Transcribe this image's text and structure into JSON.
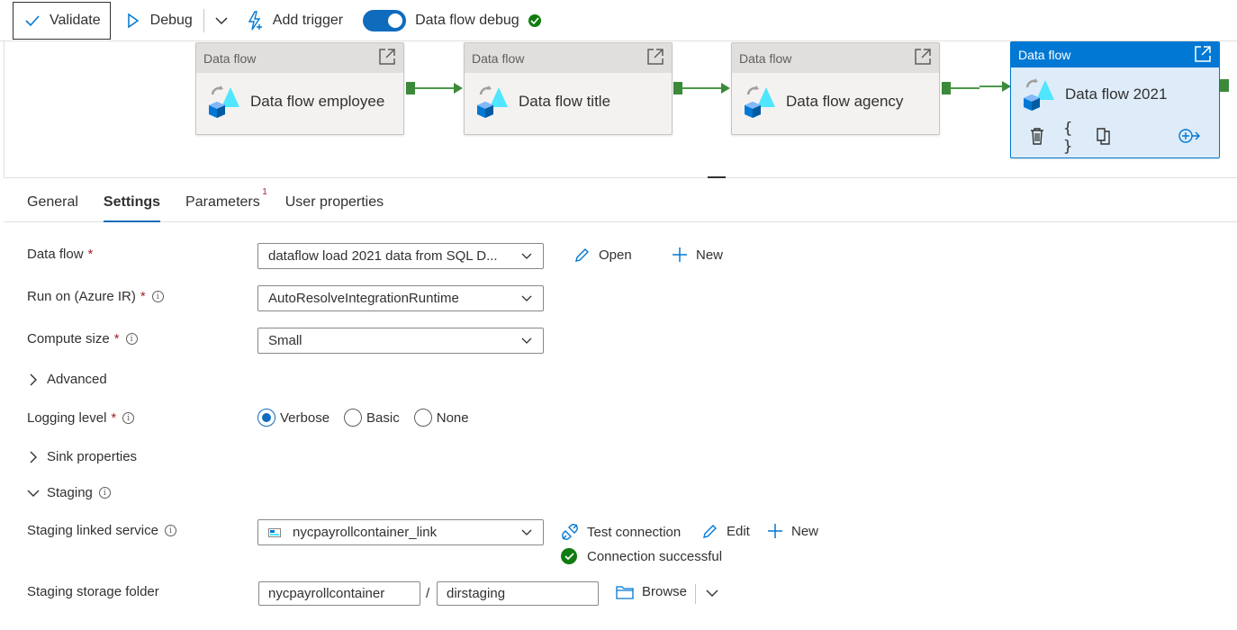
{
  "toolbar": {
    "validate": "Validate",
    "debug": "Debug",
    "add_trigger": "Add trigger",
    "data_flow_debug": "Data flow debug"
  },
  "canvas": {
    "nodes": [
      {
        "header": "Data flow",
        "name": "Data flow employee"
      },
      {
        "header": "Data flow",
        "name": "Data flow title"
      },
      {
        "header": "Data flow",
        "name": "Data flow agency"
      },
      {
        "header": "Data flow",
        "name": "Data flow 2021"
      }
    ]
  },
  "tabs": {
    "general": "General",
    "settings": "Settings",
    "parameters": "Parameters",
    "parameters_badge": "1",
    "user_properties": "User properties"
  },
  "form": {
    "data_flow": {
      "label": "Data flow",
      "value": "dataflow load 2021 data from SQL D...",
      "open": "Open",
      "new": "New"
    },
    "run_on": {
      "label": "Run on (Azure IR)",
      "value": "AutoResolveIntegrationRuntime"
    },
    "compute_size": {
      "label": "Compute size",
      "value": "Small"
    },
    "advanced": "Advanced",
    "logging_level": {
      "label": "Logging level",
      "options": [
        "Verbose",
        "Basic",
        "None"
      ],
      "selected": "Verbose"
    },
    "sink_properties": "Sink properties",
    "staging": "Staging",
    "staging_linked_service": {
      "label": "Staging linked service",
      "value": "nycpayrollcontainer_link",
      "test_connection": "Test connection",
      "edit": "Edit",
      "new": "New",
      "status": "Connection successful"
    },
    "staging_storage_folder": {
      "label": "Staging storage folder",
      "container": "nycpayrollcontainer",
      "separator": "/",
      "folder": "dirstaging",
      "browse": "Browse"
    }
  },
  "colors": {
    "accent": "#0078d4",
    "success": "#107c10",
    "required": "#a4262c",
    "pipeline_port": "#3a8a3a"
  }
}
